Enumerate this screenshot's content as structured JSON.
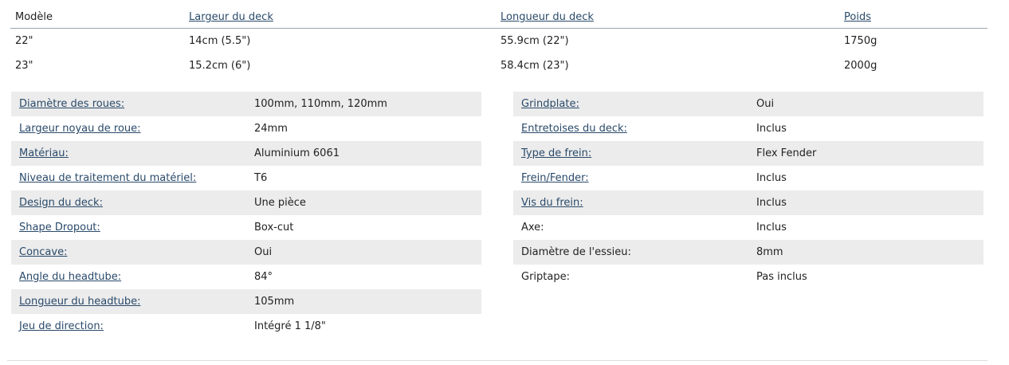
{
  "sizes": {
    "headers": [
      "Modèle",
      "Largeur du deck",
      "Longueur du deck",
      "Poids"
    ],
    "rows": [
      [
        "22\"",
        "14cm (5.5\")",
        "55.9cm (22\")",
        "1750g"
      ],
      [
        "23\"",
        "15.2cm (6\")",
        "58.4cm (23\")",
        "2000g"
      ]
    ]
  },
  "specs_left": [
    {
      "label": "Diamètre des roues:",
      "value": "100mm, 110mm, 120mm"
    },
    {
      "label": "Largeur noyau de roue:",
      "value": "24mm"
    },
    {
      "label": "Matériau:",
      "value": "Aluminium 6061"
    },
    {
      "label": "Niveau de traitement du matériel:",
      "value": "T6"
    },
    {
      "label": "Design du deck:",
      "value": "Une pièce"
    },
    {
      "label": "Shape Dropout:",
      "value": "Box-cut"
    },
    {
      "label": "Concave:",
      "value": "Oui"
    },
    {
      "label": "Angle du headtube:",
      "value": "84°"
    },
    {
      "label": "Longueur du headtube:",
      "value": "105mm"
    },
    {
      "label": "Jeu de direction:",
      "value": "Intégré 1 1/8\""
    }
  ],
  "specs_right": [
    {
      "label": "Grindplate:",
      "value": "Oui"
    },
    {
      "label": "Entretoises du deck:",
      "value": "Inclus"
    },
    {
      "label": "Type de frein:",
      "value": "Flex Fender"
    },
    {
      "label": "Frein/Fender:",
      "value": "Inclus"
    },
    {
      "label": "Vis du frein:",
      "value": "Inclus"
    },
    {
      "label": "Axe:",
      "value": "Inclus"
    },
    {
      "label": "Diamètre de l'essieu:",
      "value": "8mm"
    },
    {
      "label": "Griptape:",
      "value": "Pas inclus"
    }
  ]
}
